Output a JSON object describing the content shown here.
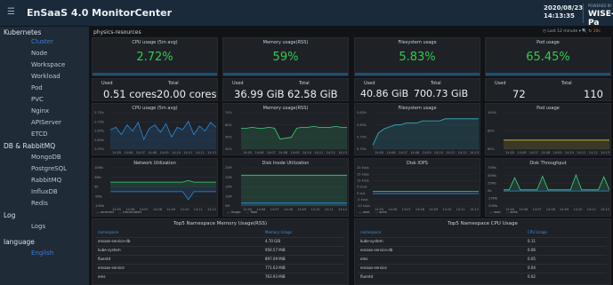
{
  "topbar": {
    "menu_icon": "hamburger-icon",
    "title": "EnSaaS 4.0 MonitorCenter",
    "date": "2020/08/23",
    "time": "14:13:35",
    "brand_small": "POWERED BY",
    "brand_big": "WISE-Pa"
  },
  "sidebar": {
    "items": [
      {
        "label": "Kubernetes",
        "kind": "head"
      },
      {
        "label": "Cluster",
        "kind": "active"
      },
      {
        "label": "Node",
        "kind": "sub"
      },
      {
        "label": "Workspace",
        "kind": "sub"
      },
      {
        "label": "Workload",
        "kind": "sub"
      },
      {
        "label": "Pod",
        "kind": "sub"
      },
      {
        "label": "PVC",
        "kind": "sub"
      },
      {
        "label": "Nginx",
        "kind": "sub"
      },
      {
        "label": "APIServer",
        "kind": "sub"
      },
      {
        "label": "ETCD",
        "kind": "sub"
      },
      {
        "label": "DB & RabbitMQ",
        "kind": "head"
      },
      {
        "label": "MongoDB",
        "kind": "sub"
      },
      {
        "label": "PostgreSQL",
        "kind": "sub"
      },
      {
        "label": "RabbitMQ",
        "kind": "sub"
      },
      {
        "label": "InfluxDB",
        "kind": "sub"
      },
      {
        "label": "Redis",
        "kind": "sub"
      },
      {
        "label": "Log",
        "kind": "head"
      },
      {
        "label": "Logs",
        "kind": "sub"
      },
      {
        "label": "language",
        "kind": "head"
      },
      {
        "label": "English",
        "kind": "active"
      }
    ]
  },
  "main": {
    "breadcrumb": "physics-resources",
    "time_range": "Last 12 minute",
    "refresh_icon": "refresh-icon",
    "zoom_icon": "zoom-out-icon",
    "refresh_interval": "10s"
  },
  "gauges": [
    {
      "title": "CPU usage (5m avg)",
      "value": "2.72%"
    },
    {
      "title": "Memory usage(RSS)",
      "value": "59%"
    },
    {
      "title": "Filesystem usage",
      "value": "5.83%"
    },
    {
      "title": "Pod usage",
      "value": "65.45%"
    }
  ],
  "stats": [
    {
      "used_label": "Used",
      "used": "0.51 cores",
      "total_label": "Total",
      "total": "20.00 cores"
    },
    {
      "used_label": "Used",
      "used": "36.99 GiB",
      "total_label": "Total",
      "total": "62.58 GiB"
    },
    {
      "used_label": "Used",
      "used": "40.86 GiB",
      "total_label": "Total",
      "total": "700.73 GiB"
    },
    {
      "used_label": "Used",
      "used": "72",
      "total_label": "Total",
      "total": "110"
    }
  ],
  "colors": {
    "green": "#35c94d",
    "line_blue": "#2b8be0",
    "line_green": "#3fd07a",
    "line_teal": "#37b5c8"
  },
  "chart_data": [
    {
      "type": "line",
      "title": "CPU usage (5m avg)",
      "yticks": [
        "2.75%",
        "2.70%",
        "2.65%",
        "2.60%",
        "2.55%"
      ],
      "xticks": [
        "14:05",
        "14:06",
        "14:07",
        "14:08",
        "14:09",
        "14:10",
        "14:11",
        "14:12",
        "14:13"
      ],
      "ylim": [
        2.5,
        2.8
      ],
      "series": [
        {
          "values": [
            2.66,
            2.68,
            2.62,
            2.7,
            2.65,
            2.72,
            2.58,
            2.67,
            2.7,
            2.64,
            2.71,
            2.6,
            2.68,
            2.66,
            2.73,
            2.62,
            2.69,
            2.65,
            2.72,
            2.68
          ]
        }
      ]
    },
    {
      "type": "line",
      "title": "Memory usage(RSS)",
      "yticks": [
        "70%",
        "60%",
        "50%",
        "40%"
      ],
      "xticks": [
        "14:05",
        "14:06",
        "14:07",
        "14:08",
        "14:09",
        "14:10",
        "14:11",
        "14:12",
        "14:13"
      ],
      "ylim": [
        35,
        75
      ],
      "series": [
        {
          "values": [
            58,
            58,
            59,
            58,
            58,
            59,
            58,
            46,
            47,
            48,
            58,
            59,
            59,
            60,
            59,
            59,
            59,
            60,
            59,
            59
          ]
        }
      ]
    },
    {
      "type": "line",
      "title": "Filesystem usage",
      "yticks": [
        "5.85%",
        "5.80%",
        "5.75%",
        "5.70%"
      ],
      "xticks": [
        "14:05",
        "14:06",
        "14:07",
        "14:08",
        "14:09",
        "14:10",
        "14:11",
        "14:12",
        "14:13"
      ],
      "ylim": [
        5.68,
        5.86
      ],
      "series": [
        {
          "values": [
            5.7,
            5.76,
            5.78,
            5.79,
            5.8,
            5.8,
            5.81,
            5.81,
            5.81,
            5.82,
            5.82,
            5.82,
            5.82,
            5.83,
            5.83,
            5.83,
            5.83,
            5.83,
            5.83,
            5.83
          ]
        }
      ]
    },
    {
      "type": "line",
      "title": "Pod usage",
      "yticks": [
        "100%",
        "80%",
        "60%"
      ],
      "xticks": [
        "14:05",
        "14:06",
        "14:07",
        "14:08",
        "14:09",
        "14:10",
        "14:11",
        "14:12",
        "14:13"
      ],
      "ylim": [
        50,
        110
      ],
      "series": [
        {
          "values": [
            65,
            65,
            65,
            65,
            65,
            65,
            65,
            65,
            65,
            65,
            65,
            65,
            65,
            65,
            65,
            65,
            65,
            65,
            65,
            65
          ]
        }
      ]
    },
    {
      "type": "line",
      "title": "Network Utilization",
      "yticks": [
        "10Mb",
        "5Mb",
        "0b",
        "-5Mb",
        "-10Mb"
      ],
      "xticks": [
        "14:05",
        "14:06",
        "14:07",
        "14:08",
        "14:09",
        "14:10",
        "14:11",
        "14:12"
      ],
      "ylim": [
        -12,
        12
      ],
      "legend": [
        "received",
        "transmitted"
      ],
      "series": [
        {
          "name": "received",
          "values": [
            3,
            3,
            3,
            3,
            3,
            3,
            3,
            3,
            3,
            3,
            3,
            3,
            3,
            3,
            4,
            3,
            3,
            3,
            3,
            3
          ]
        },
        {
          "name": "transmitted",
          "values": [
            -3,
            -3,
            -3,
            -3,
            -3,
            -3,
            -3,
            -3,
            -3,
            -3,
            -3,
            -3,
            -3,
            -3,
            -8,
            -3,
            -3,
            -3,
            -3,
            -3
          ]
        }
      ]
    },
    {
      "type": "line",
      "title": "Disk Inode Utilization",
      "yticks": [
        "25M",
        "20M",
        "15M",
        "10M",
        "5M"
      ],
      "xticks": [
        "14:05",
        "14:06",
        "14:07",
        "14:08",
        "14:09",
        "14:10",
        "14:11",
        "14:12"
      ],
      "ylim": [
        0,
        26
      ],
      "legend": [
        "Usage",
        "Total"
      ],
      "series": [
        {
          "name": "Total",
          "values": [
            21,
            21,
            21,
            21,
            21,
            21,
            21,
            21,
            21,
            21,
            21,
            21,
            21,
            21,
            21,
            21,
            21,
            21,
            21,
            21
          ]
        },
        {
          "name": "Usage",
          "values": [
            2,
            2,
            2,
            2,
            2,
            2,
            2,
            2,
            2,
            2,
            2,
            2,
            2,
            2,
            2,
            2,
            2,
            2,
            2,
            2
          ]
        }
      ]
    },
    {
      "type": "line",
      "title": "Disk IOPS",
      "yticks": [
        "20 kio/s",
        "15 kio/s",
        "10 kio/s",
        "5 kio/s",
        "0 io/s",
        "-5 kio/s",
        "-10 kio/s"
      ],
      "xticks": [
        "14:05",
        "14:06",
        "14:07",
        "14:08",
        "14:09",
        "14:10",
        "14:11",
        "14:12"
      ],
      "ylim": [
        -12,
        22
      ],
      "legend": [
        "read",
        "write"
      ],
      "series": [
        {
          "name": "read",
          "values": [
            1,
            1,
            1,
            1,
            1,
            1,
            1,
            1,
            1,
            1,
            1,
            1,
            1,
            1,
            1,
            1,
            1,
            1,
            1,
            1
          ]
        },
        {
          "name": "write",
          "values": [
            -1,
            -1,
            -1,
            -1,
            -1,
            -1,
            -1,
            -1,
            -1,
            -1,
            -1,
            -1,
            -1,
            -1,
            -1,
            -1,
            -1,
            -1,
            -1,
            -1
          ]
        }
      ]
    },
    {
      "type": "line",
      "title": "Disk Throughput",
      "yticks": [
        "75Mb",
        "50Mb",
        "25Mb",
        "0b",
        "-25Mb",
        "-50Mb"
      ],
      "xticks": [
        "14:05",
        "14:06",
        "14:07",
        "14:08",
        "14:09",
        "14:10",
        "14:11",
        "14:12"
      ],
      "ylim": [
        -55,
        80
      ],
      "legend": [
        "read",
        "write"
      ],
      "series": [
        {
          "name": "read",
          "values": [
            2,
            2,
            45,
            2,
            2,
            2,
            2,
            50,
            2,
            2,
            2,
            2,
            2,
            55,
            2,
            2,
            2,
            2,
            48,
            2
          ]
        },
        {
          "name": "write",
          "values": [
            -2,
            -2,
            -2,
            -2,
            -2,
            -2,
            -2,
            -2,
            -2,
            -2,
            -2,
            -2,
            -2,
            -2,
            -2,
            -2,
            -2,
            -2,
            -2,
            -2
          ]
        }
      ]
    }
  ],
  "tables": [
    {
      "title": "Top5 Namespace Memory Usage(RSS)",
      "headers": [
        "namespace",
        "Memory Usage"
      ],
      "rows": [
        [
          "ensaas-service-db",
          "4.70 GiB"
        ],
        [
          "kube-system",
          "956.57 MiB"
        ],
        [
          "fluentd",
          "897.09 MiB"
        ],
        [
          "ensaas-service",
          "771.63 MiB"
        ],
        [
          "ems",
          "763.93 MiB"
        ]
      ]
    },
    {
      "title": "Top5 Namespace CPU Usage",
      "headers": [
        "namespace",
        "CPU Usage"
      ],
      "rows": [
        [
          "kube-system",
          "0.11"
        ],
        [
          "ensaas-service-db",
          "0.06"
        ],
        [
          "ems",
          "0.05"
        ],
        [
          "ensaas-service",
          "0.04"
        ],
        [
          "fluentd",
          "0.02"
        ]
      ]
    }
  ]
}
